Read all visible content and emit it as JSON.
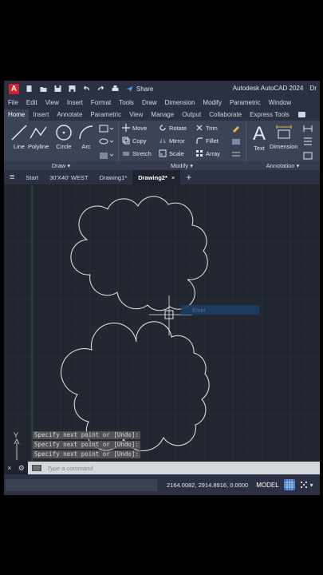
{
  "titlebar": {
    "logo": "A",
    "share": "Share",
    "app_title": "Autodesk AutoCAD 2024",
    "app_title_suffix": "Dr"
  },
  "menu": [
    "File",
    "Edit",
    "View",
    "Insert",
    "Format",
    "Tools",
    "Draw",
    "Dimension",
    "Modify",
    "Parametric",
    "Window"
  ],
  "ribbon_tabs": [
    "Home",
    "Insert",
    "Annotate",
    "Parametric",
    "View",
    "Manage",
    "Output",
    "Collaborate",
    "Express Tools"
  ],
  "ribbon_active_tab": "Home",
  "draw_panel": {
    "line": "Line",
    "polyline": "Polyline",
    "circle": "Circle",
    "arc": "Arc",
    "title": "Draw"
  },
  "modify_panel": {
    "move": "Move",
    "rotate": "Rotate",
    "trim": "Trim",
    "copy": "Copy",
    "mirror": "Mirror",
    "fillet": "Fillet",
    "stretch": "Stretch",
    "scale": "Scale",
    "array": "Array",
    "title": "Modify"
  },
  "annotation_panel": {
    "text": "Text",
    "dimension": "Dimension",
    "title": "Annotation"
  },
  "doc_tabs": [
    "Start",
    "30'X40' WEST",
    "Drawing1*",
    "Drawing2*"
  ],
  "active_doc": "Drawing2*",
  "cursor_tooltip": "Enter",
  "command_history": [
    "Specify next point or [Undo]:",
    "Specify next point or [Undo]:",
    "Specify next point or [Undo]:"
  ],
  "command_placeholder": "Type a command",
  "status": {
    "coords": "2164.0082, 2914.8916, 0.0000",
    "space": "MODEL"
  },
  "axis_label": "Y",
  "colors": {
    "accent": "#0a6fd6",
    "canvas": "#212630",
    "grid": "#2d3340",
    "ucs_green": "#3fa04a",
    "ucs_red": "#a03030"
  }
}
